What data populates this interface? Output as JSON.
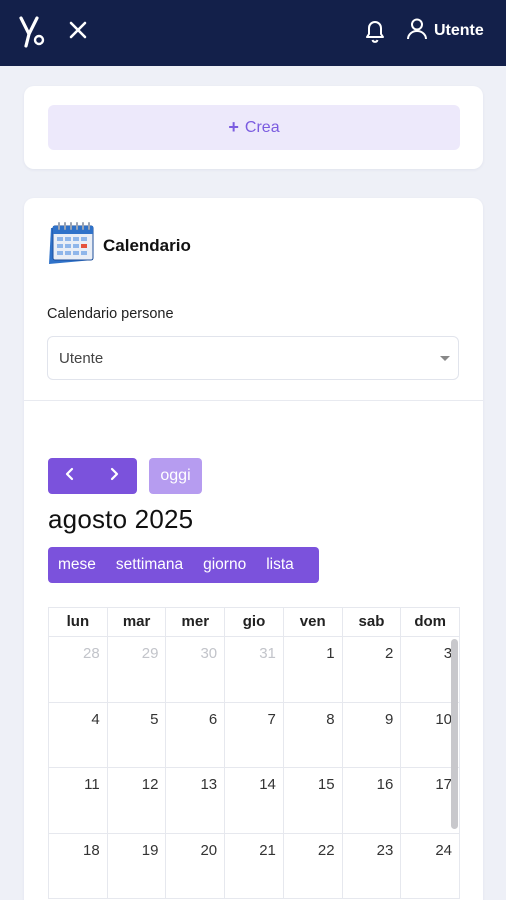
{
  "header": {
    "logo_icon": "yeo-logo-icon",
    "close_icon": "close-icon",
    "bell_icon": "bell-icon",
    "user_icon": "user-icon",
    "user_name": "Utente",
    "bg_color": "#13204a"
  },
  "create": {
    "plus": "+",
    "label": "Crea"
  },
  "calendar_card": {
    "icon": "calendar-icon",
    "title": "Calendario",
    "field_label": "Calendario persone",
    "select_value": "Utente"
  },
  "calendar": {
    "prev_icon": "chevron-left-icon",
    "next_icon": "chevron-right-icon",
    "today_label": "oggi",
    "month_title": "agosto 2025",
    "views": [
      "mese",
      "settimana",
      "giorno",
      "lista"
    ],
    "weekdays": [
      "lun",
      "mar",
      "mer",
      "gio",
      "ven",
      "sab",
      "dom"
    ],
    "weeks": [
      [
        {
          "d": "28",
          "m": true
        },
        {
          "d": "29",
          "m": true
        },
        {
          "d": "30",
          "m": true
        },
        {
          "d": "31",
          "m": true
        },
        {
          "d": "1",
          "m": false
        },
        {
          "d": "2",
          "m": false
        },
        {
          "d": "3",
          "m": false
        }
      ],
      [
        {
          "d": "4",
          "m": false
        },
        {
          "d": "5",
          "m": false
        },
        {
          "d": "6",
          "m": false
        },
        {
          "d": "7",
          "m": false
        },
        {
          "d": "8",
          "m": false
        },
        {
          "d": "9",
          "m": false
        },
        {
          "d": "10",
          "m": false
        }
      ],
      [
        {
          "d": "11",
          "m": false
        },
        {
          "d": "12",
          "m": false
        },
        {
          "d": "13",
          "m": false
        },
        {
          "d": "14",
          "m": false
        },
        {
          "d": "15",
          "m": false
        },
        {
          "d": "16",
          "m": false
        },
        {
          "d": "17",
          "m": false
        }
      ],
      [
        {
          "d": "18",
          "m": false
        },
        {
          "d": "19",
          "m": false
        },
        {
          "d": "20",
          "m": false
        },
        {
          "d": "21",
          "m": false
        },
        {
          "d": "22",
          "m": false
        },
        {
          "d": "23",
          "m": false
        },
        {
          "d": "24",
          "m": false
        }
      ]
    ],
    "accent_color": "#7b52dc",
    "today_color": "#b69cf0"
  }
}
